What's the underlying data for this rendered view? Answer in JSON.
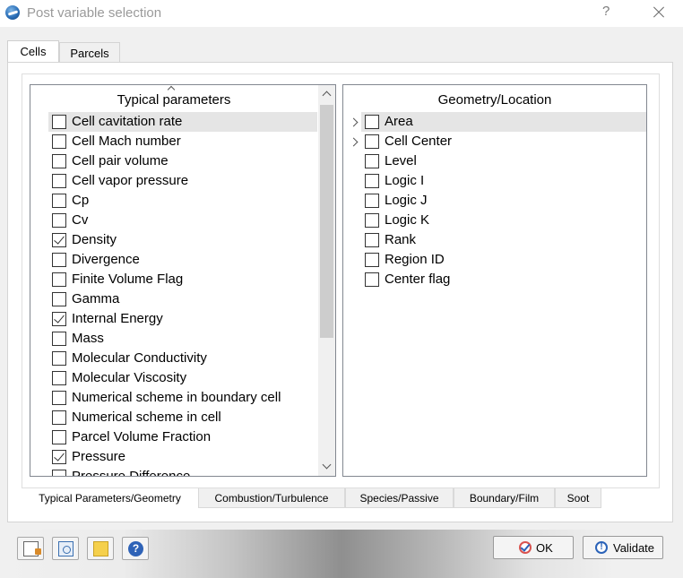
{
  "window": {
    "title": "Post variable selection",
    "help_glyph": "?",
    "icons": {
      "app": "app-logo-icon",
      "close": "close-icon"
    }
  },
  "top_tabs": [
    {
      "label": "Cells",
      "active": true
    },
    {
      "label": "Parcels",
      "active": false
    }
  ],
  "typical": {
    "header": "Typical parameters",
    "items": [
      {
        "label": "Cell cavitation rate",
        "checked": false
      },
      {
        "label": "Cell Mach number",
        "checked": false
      },
      {
        "label": "Cell pair volume",
        "checked": false
      },
      {
        "label": "Cell vapor pressure",
        "checked": false
      },
      {
        "label": "Cp",
        "checked": false
      },
      {
        "label": "Cv",
        "checked": false
      },
      {
        "label": "Density",
        "checked": true
      },
      {
        "label": "Divergence",
        "checked": false
      },
      {
        "label": "Finite Volume Flag",
        "checked": false
      },
      {
        "label": "Gamma",
        "checked": false
      },
      {
        "label": "Internal Energy",
        "checked": true
      },
      {
        "label": "Mass",
        "checked": false
      },
      {
        "label": "Molecular Conductivity",
        "checked": false
      },
      {
        "label": "Molecular Viscosity",
        "checked": false
      },
      {
        "label": "Numerical scheme in boundary cell",
        "checked": false
      },
      {
        "label": "Numerical scheme in cell",
        "checked": false
      },
      {
        "label": "Parcel Volume Fraction",
        "checked": false
      },
      {
        "label": "Pressure",
        "checked": true
      },
      {
        "label": "Pressure Difference",
        "checked": false
      }
    ]
  },
  "geometry": {
    "header": "Geometry/Location",
    "items": [
      {
        "label": "Area",
        "checked": false,
        "expandable": true
      },
      {
        "label": "Cell Center",
        "checked": false,
        "expandable": true
      },
      {
        "label": "Level",
        "checked": false,
        "expandable": false
      },
      {
        "label": "Logic I",
        "checked": false,
        "expandable": false
      },
      {
        "label": "Logic J",
        "checked": false,
        "expandable": false
      },
      {
        "label": "Logic K",
        "checked": false,
        "expandable": false
      },
      {
        "label": "Rank",
        "checked": false,
        "expandable": false
      },
      {
        "label": "Region ID",
        "checked": false,
        "expandable": false
      },
      {
        "label": "Center flag",
        "checked": false,
        "expandable": false
      }
    ]
  },
  "bottom_tabs": [
    {
      "label": "Typical Parameters/Geometry",
      "active": true
    },
    {
      "label": "Combustion/Turbulence",
      "active": false
    },
    {
      "label": "Species/Passive",
      "active": false
    },
    {
      "label": "Boundary/Film",
      "active": false
    },
    {
      "label": "Soot",
      "active": false
    }
  ],
  "footer": {
    "tools": [
      "export-icon",
      "clipboard-icon",
      "note-icon",
      "help-icon"
    ],
    "help_tool_glyph": "?",
    "ok_label": "OK",
    "validate_label": "Validate",
    "validate_glyph": "!"
  }
}
